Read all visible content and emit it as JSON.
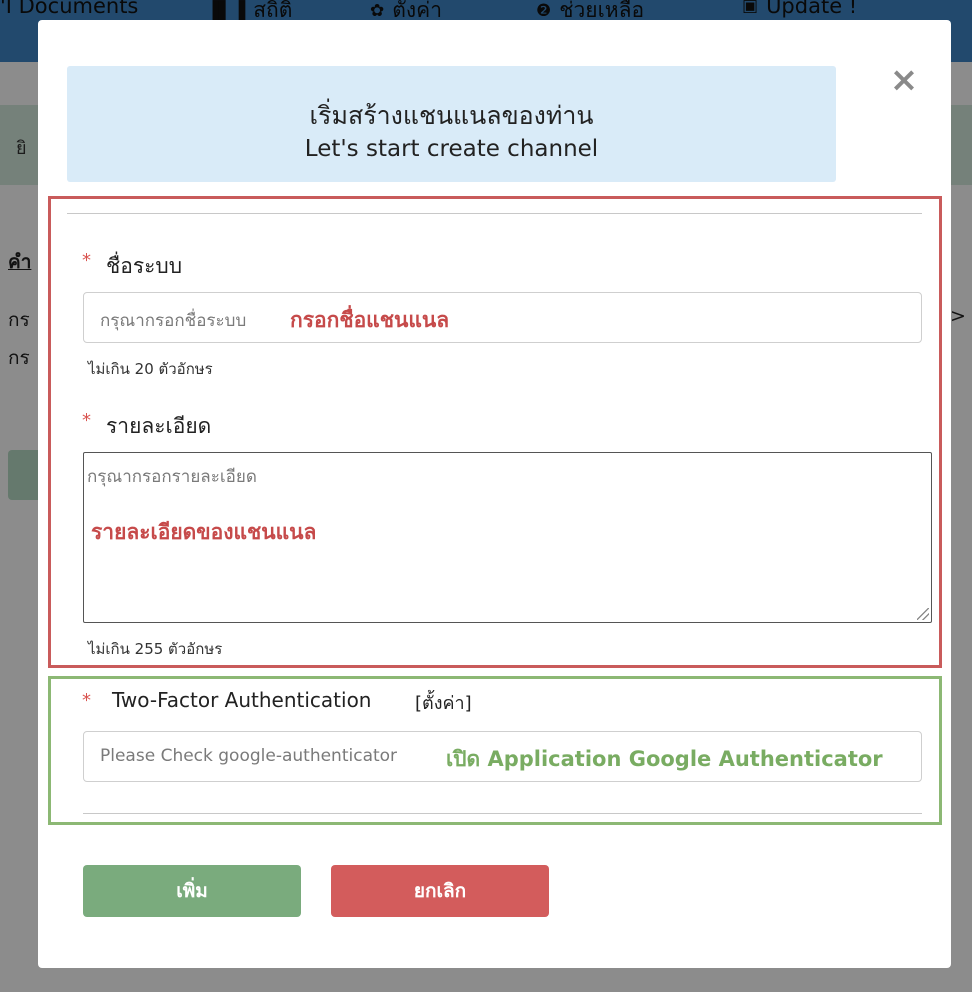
{
  "background": {
    "nav": [
      {
        "icon": "",
        "label": "'I Documents"
      },
      {
        "icon": "▐▌▐",
        "label": "สถิติ"
      },
      {
        "icon": "✿",
        "label": "ตั้งค่า"
      },
      {
        "icon": "❷",
        "label": "ช่วยเหลือ"
      },
      {
        "icon": "▣",
        "label": "Update !"
      }
    ],
    "band1_text": "ยิ",
    "heading": "คำ",
    "line1": "กร",
    "line2": "กร",
    "right_chevron": "> "
  },
  "modal": {
    "header_th": "เริ่มสร้างแชนแนลของท่าน",
    "header_en": "Let's start create channel",
    "close": "×",
    "name_field": {
      "required_mark": "*",
      "label": "ชื่อระบบ",
      "placeholder": "กรุณากรอกชื่อระบบ",
      "annotation": "กรอกชื่อแชนแนล",
      "hint": "ไม่เกิน 20 ตัวอักษร"
    },
    "detail_field": {
      "required_mark": "*",
      "label": "รายละเอียด",
      "placeholder": "กรุณากรอกรายละเอียด",
      "annotation": "รายละเอียดของแชนแนล",
      "hint": "ไม่เกิน 255 ตัวอักษร"
    },
    "twofa_field": {
      "required_mark": "*",
      "label": "Two-Factor Authentication",
      "settings_link": "[ตั้งค่า]",
      "placeholder": "Please Check google-authenticator",
      "annotation": "เปิด Application Google Authenticator"
    },
    "buttons": {
      "add": "เพิ่ม",
      "cancel": "ยกเลิก"
    },
    "colors": {
      "header_bg": "#d9ebf8",
      "add_button": "#7aab7d",
      "cancel_button": "#d35c5c",
      "highlight_red": "#c95b5b",
      "highlight_green": "#8cb874"
    }
  }
}
